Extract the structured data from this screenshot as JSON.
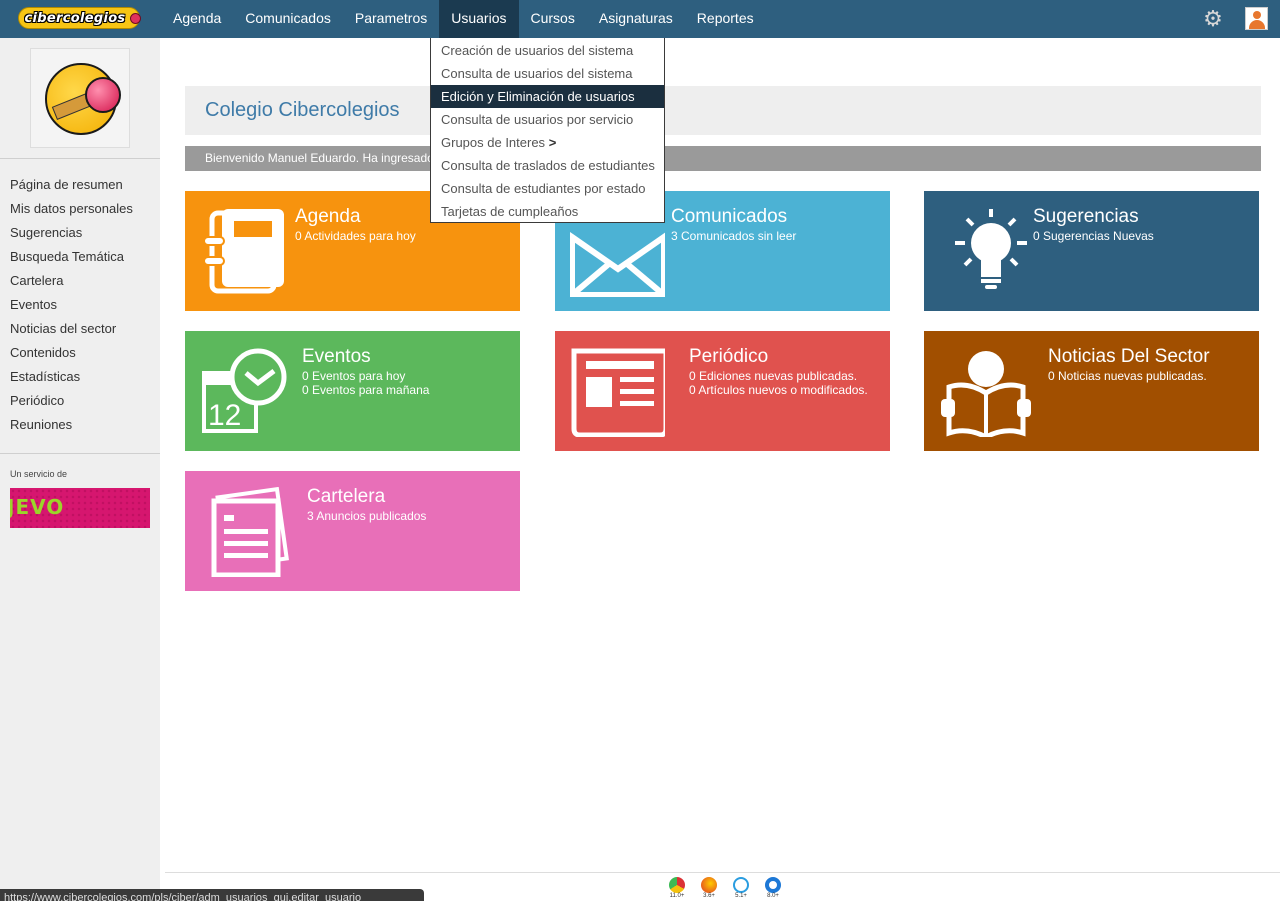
{
  "nav": {
    "logo_text": "cibercolegios",
    "items": [
      {
        "label": "Agenda"
      },
      {
        "label": "Comunicados"
      },
      {
        "label": "Parametros"
      },
      {
        "label": "Usuarios"
      },
      {
        "label": "Cursos"
      },
      {
        "label": "Asignaturas"
      },
      {
        "label": "Reportes"
      }
    ],
    "active": "Usuarios"
  },
  "dropdown": {
    "items": [
      {
        "label": "Creación de usuarios del sistema"
      },
      {
        "label": "Consulta de usuarios del sistema"
      },
      {
        "label": "Edición y Eliminación de usuarios"
      },
      {
        "label": "Consulta de usuarios por servicio"
      },
      {
        "label": "Grupos de Interes",
        "submenu": ">"
      },
      {
        "label": "Consulta de traslados de estudiantes"
      },
      {
        "label": "Consulta de estudiantes por estado"
      },
      {
        "label": "Tarjetas de cumpleaños"
      }
    ],
    "selected": "Edición y Eliminación de usuarios"
  },
  "sidebar": {
    "links": [
      {
        "label": "Página de resumen"
      },
      {
        "label": "Mis datos personales"
      },
      {
        "label": "Sugerencias"
      },
      {
        "label": "Busqueda Temática"
      },
      {
        "label": "Cartelera"
      },
      {
        "label": "Eventos"
      },
      {
        "label": "Noticias del sector"
      },
      {
        "label": "Contenidos"
      },
      {
        "label": "Estadísticas"
      },
      {
        "label": "Periódico"
      },
      {
        "label": "Reuniones"
      }
    ],
    "service_label": "Un servicio de",
    "banner_text": "JEVO"
  },
  "main": {
    "school_name": "Colegio Cibercolegios",
    "welcome": "Bienvenido Manuel Eduardo. Ha ingresado"
  },
  "tiles": [
    {
      "title": "Agenda",
      "lines": [
        "0 Actividades para hoy"
      ],
      "color": "#f7930e",
      "icon": "notebook-icon"
    },
    {
      "title": "Comunicados",
      "lines": [
        "3 Comunicados sin leer"
      ],
      "color": "#4cb2d4",
      "icon": "envelope-icon"
    },
    {
      "title": "Sugerencias",
      "lines": [
        "0 Sugerencias Nuevas"
      ],
      "color": "#2e5f7f",
      "icon": "lightbulb-icon"
    },
    {
      "title": "Eventos",
      "lines": [
        "0 Eventos para hoy",
        "0 Eventos para mañana"
      ],
      "color": "#5cb85c",
      "icon": "calendar-clock-icon"
    },
    {
      "title": "Periódico",
      "lines": [
        "0 Ediciones nuevas publicadas.",
        "0 Artículos nuevos o modificados."
      ],
      "color": "#e0524e",
      "icon": "newspaper-icon"
    },
    {
      "title": "Noticias Del Sector",
      "lines": [
        "0 Noticias nuevas publicadas."
      ],
      "color": "#a14f00",
      "icon": "reader-icon"
    },
    {
      "title": "Cartelera",
      "lines": [
        "3 Anuncios publicados"
      ],
      "color": "#e86fb8",
      "icon": "bulletin-icon"
    }
  ],
  "footer": {
    "browsers": [
      {
        "name": "chrome-icon",
        "version": "11.0+",
        "color": "#2a8f3b"
      },
      {
        "name": "firefox-icon",
        "version": "3.6+",
        "color": "#e8611c"
      },
      {
        "name": "safari-icon",
        "version": "5.1+",
        "color": "#2a9de0"
      },
      {
        "name": "ie-icon",
        "version": "8.0+",
        "color": "#1d78d6"
      }
    ],
    "status_url": "https://www.cibercolegios.com/pls/ciber/adm_usuarios_gui.editar_usuario"
  }
}
